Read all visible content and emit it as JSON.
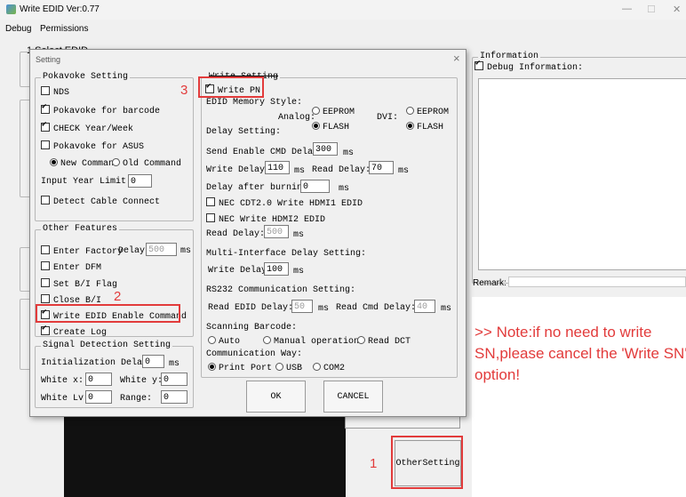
{
  "app": {
    "title": "Write EDID  Ver:0.77",
    "menu": [
      "Debug",
      "Permissions"
    ],
    "controls": [
      "—",
      "☐",
      "✕"
    ],
    "bg_select_label": "1 Select EDID"
  },
  "information": {
    "title": "Information",
    "debug_label": "Debug Information:",
    "remark_label": "Remark:",
    "note": ">> Note:if no need to write SN,please cancel the 'Write SN' option!"
  },
  "other_setting_button": "OtherSetting",
  "callouts": {
    "one": "1",
    "two": "2",
    "three": "3"
  },
  "dialog": {
    "title": "Setting",
    "close": "×",
    "pokavoke": {
      "title": "Pokavoke Setting",
      "nds": "NDS",
      "barcode": "Pokavoke for barcode",
      "check_year": "CHECK Year/Week",
      "asus": "Pokavoke for ASUS",
      "new_command": "New Command",
      "old_command": "Old Command",
      "input_year_limit": "Input Year Limit",
      "input_year_value": "0",
      "detect_cable": "Detect Cable Connect"
    },
    "other": {
      "title": "Other Features",
      "enter_factory": "Enter Factory",
      "delay": "Delay:",
      "delay_value": "500",
      "ms": "ms",
      "enter_dfm": "Enter DFM",
      "set_bi": "Set B/I Flag",
      "close_bi": "Close B/I",
      "write_edid": "Write EDID Enable Command",
      "create_log": "Create Log"
    },
    "signal": {
      "title": "Signal Detection Setting",
      "init_delay": "Initialization Delay:",
      "init_value": "0",
      "ms": "ms",
      "white_x": "White x:",
      "white_x_value": "0",
      "white_y": "White y:",
      "white_y_value": "0",
      "white_lv": "White Lv:",
      "white_lv_value": "0",
      "range": "Range:",
      "range_value": "0"
    },
    "write": {
      "title": "Write Setting",
      "write_pn": "Write PN",
      "memory_style": "EDID Memory Style:",
      "analog": "Analog:",
      "dvi": "DVI:",
      "eeprom": "EEPROM",
      "flash": "FLASH",
      "delay_setting": "Delay Setting:",
      "send_enable": "Send Enable CMD Delay:",
      "send_enable_value": "300",
      "ms": "ms",
      "write_delay": "Write Delay:",
      "write_delay_value": "110",
      "read_delay": "Read Delay:",
      "read_delay_value": "70",
      "after_burning": "Delay after burning:",
      "after_burning_value": "0",
      "nec_cdt": "NEC CDT2.0 Write HDMI1 EDID",
      "nec_hdmi2": "NEC Write HDMI2 EDID",
      "read_delay2": "Read Delay:",
      "read_delay2_value": "500",
      "multi_title": "Multi-Interface Delay Setting:",
      "multi_write": "Write Delay:",
      "multi_write_value": "100",
      "rs232_title": "RS232 Communication Setting:",
      "read_edid_delay": "Read EDID Delay:",
      "read_edid_value": "50",
      "read_cmd_delay": "Read Cmd Delay:",
      "read_cmd_value": "40",
      "scanning": "Scanning Barcode:",
      "auto": "Auto",
      "manual": "Manual operation",
      "read_dct": "Read DCT",
      "comm_way": "Communication Way:",
      "print_port": "Print Port",
      "usb": "USB",
      "com2": "COM2"
    },
    "ok": "OK",
    "cancel": "CANCEL"
  }
}
